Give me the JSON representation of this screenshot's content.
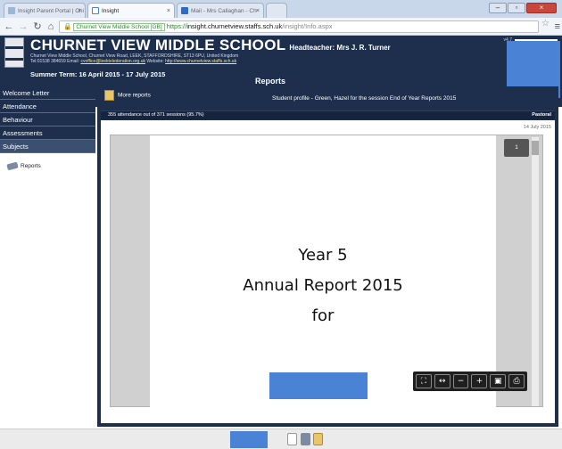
{
  "browser": {
    "tabs": [
      {
        "label": "Insight Parent Portal | Chi",
        "active": false
      },
      {
        "label": "Insight",
        "active": true
      },
      {
        "label": "Mail - Mrs Callaghan - Ch",
        "active": false
      }
    ],
    "url": {
      "site_label": "Churnet View Middle School [GB]",
      "scheme": "https://",
      "host": "insight.churnetview.staffs.sch.uk",
      "path": "/insight/Info.aspx"
    }
  },
  "school": {
    "name": "CHURNET VIEW MIDDLE SCHOOL",
    "headteacher": "Headteacher: Mrs J. R. Turner",
    "address": "Churnet View Middle School, Churnet View Road, LEEK, STAFFORDSHIRE, ST13 6PU, United Kingdom",
    "tel": "Tel:01538 384659",
    "email_label": "Email:",
    "email": "cvoffice@leektelederation.org.uk",
    "website_label": "Website:",
    "website": "http://www.churnetview.staffs.sch.uk",
    "version": "v4.7"
  },
  "term": "Summer Term: 16 April 2015 - 17 July 2015",
  "page_heading": "Reports",
  "sidebar": {
    "items": [
      "Welcome Letter",
      "Attendance",
      "Behaviour",
      "Assessments",
      "Subjects"
    ],
    "active_index": 4,
    "link": "Reports"
  },
  "main": {
    "more_reports": "More reports",
    "profile_title": "Student profile - Green, Hazel for the session End of Year Reports 2015",
    "attendance": "355 attendance out of 371 sessions (95.7%)",
    "pastoral": "Pastoral",
    "date": "14 July 2015"
  },
  "pdf": {
    "lines": [
      "Year 5",
      "Annual Report 2015",
      "for"
    ],
    "page_number": "1",
    "tools": [
      "fit-page-icon",
      "fit-width-icon",
      "zoom-out-icon",
      "zoom-in-icon",
      "save-icon",
      "print-icon"
    ]
  },
  "colors": {
    "header_bg": "#1d2f4d",
    "redaction": "#4a82d6",
    "accent_green": "#33a14a"
  }
}
